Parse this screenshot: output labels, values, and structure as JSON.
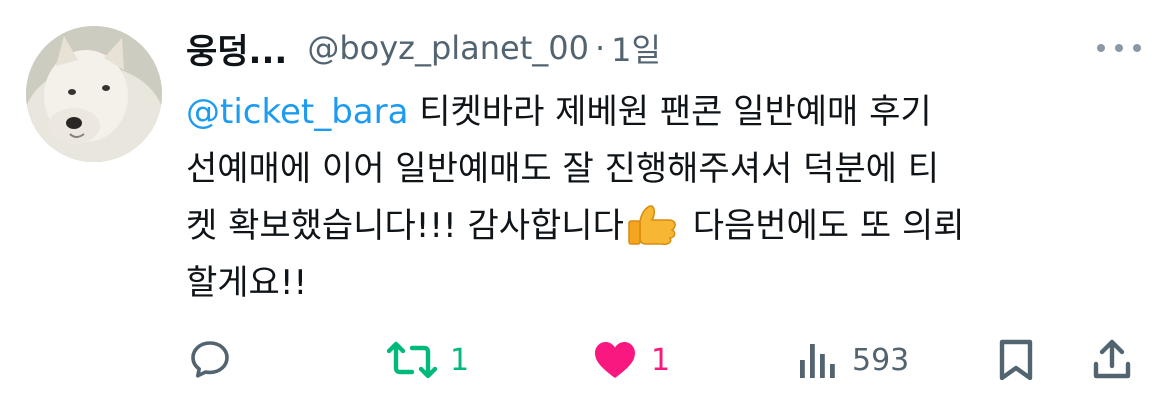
{
  "tweet": {
    "author_name": "웅덩...",
    "handle": "@boyz_planet_00",
    "separator": "·",
    "time": "1일",
    "mention": "@ticket_bara",
    "lines": {
      "l1": "티켓바라 제베원 팬콘 일반예매 후기",
      "l2": "선예매에 이어 일반예매도 잘 진행해주셔서 덕분에 티",
      "l3a": "켓 확보했습니다!!! 감사합니다",
      "l3b": "다음번에도 또 의뢰",
      "l4": "할게요!!"
    },
    "emoji": "thumbs-up"
  },
  "actions": {
    "reply_icon": "reply-icon",
    "retweet_count": "1",
    "like_count": "1",
    "views_count": "593",
    "bookmark_icon": "bookmark-icon",
    "share_icon": "share-icon"
  },
  "colors": {
    "link": "#1d9bf0",
    "retweet_active": "#00ba7c",
    "like_active": "#f91880",
    "secondary": "#536471"
  }
}
